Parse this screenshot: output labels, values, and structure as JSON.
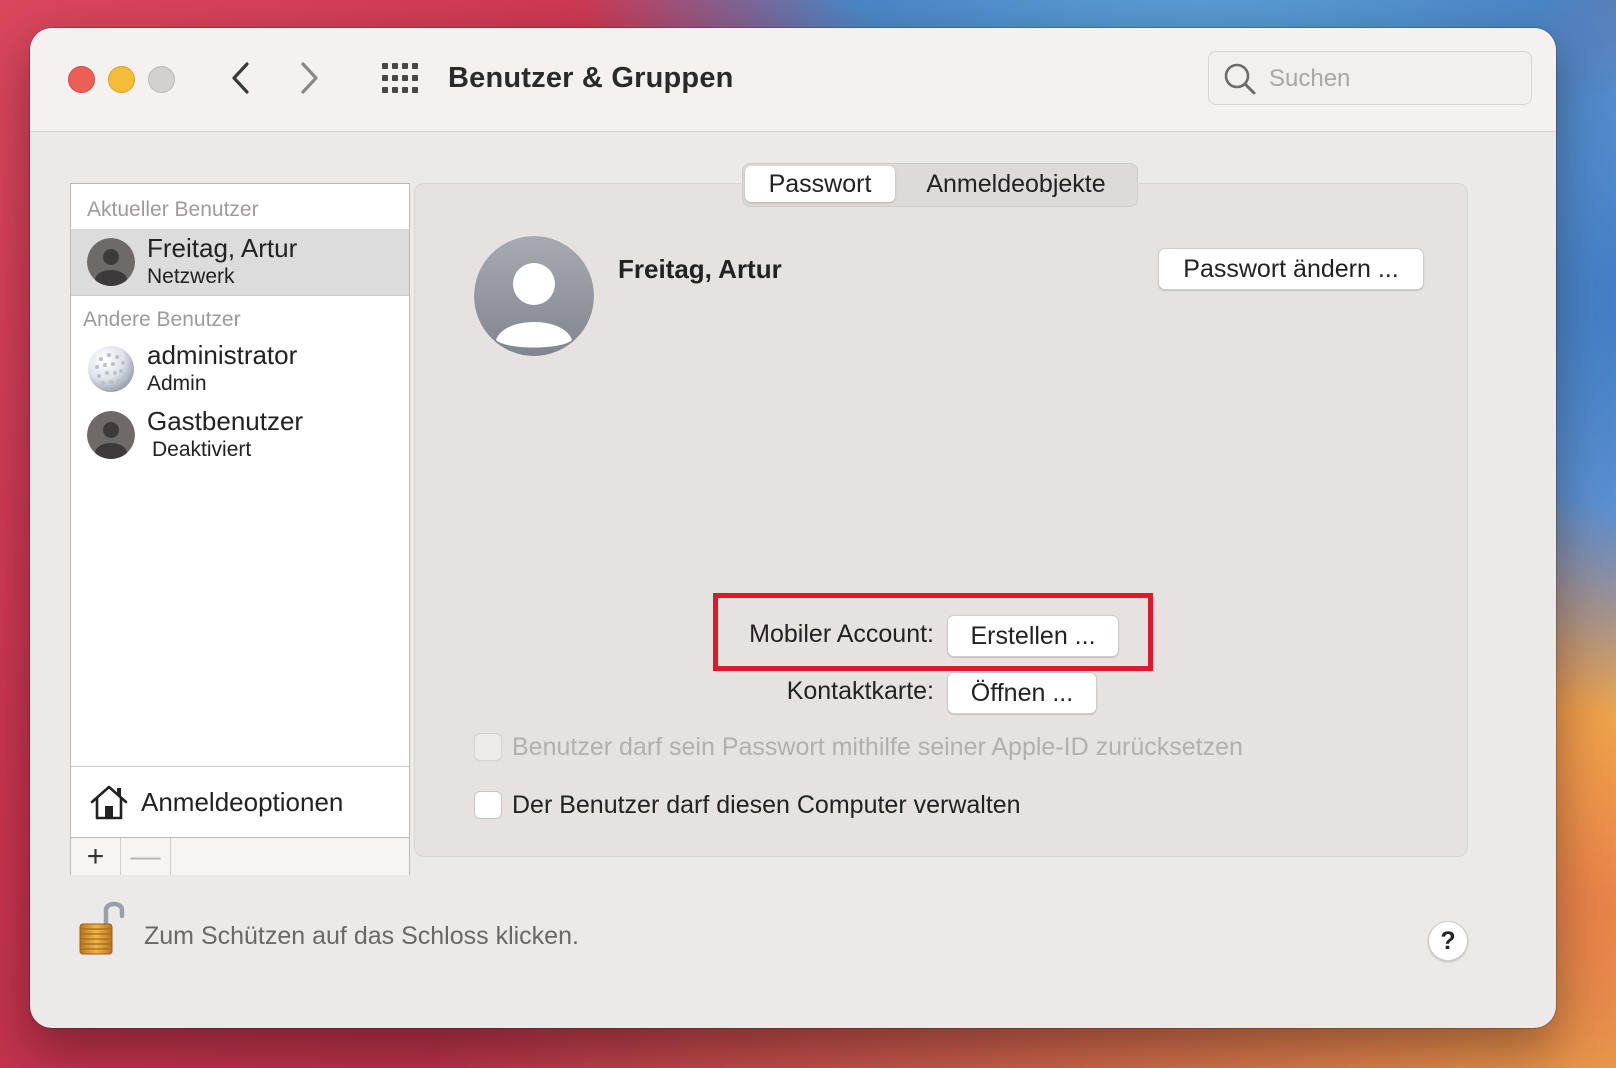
{
  "window": {
    "title": "Benutzer & Gruppen"
  },
  "search": {
    "placeholder": "Suchen"
  },
  "sidebar": {
    "current_section": "Aktueller Benutzer",
    "current_user": {
      "name": "Freitag, Artur",
      "role": "Netzwerk"
    },
    "other_section": "Andere Benutzer",
    "other_users": [
      {
        "name": "administrator",
        "role": "Admin"
      },
      {
        "name": "Gastbenutzer",
        "role": "Deaktiviert"
      }
    ],
    "login_options_label": "Anmeldeoptionen",
    "add_label": "+",
    "remove_label": "—"
  },
  "tabs": [
    {
      "label": "Passwort",
      "active": true
    },
    {
      "label": "Anmeldeobjekte",
      "active": false
    }
  ],
  "main": {
    "user_name": "Freitag, Artur",
    "change_password_label": "Passwort ändern ...",
    "mobile_account_label": "Mobiler Account:",
    "create_label": "Erstellen ...",
    "contact_card_label": "Kontaktkarte:",
    "open_label": "Öffnen ...",
    "checkbox_apple_id": {
      "label": "Benutzer darf sein Passwort mithilfe seiner Apple-ID zurücksetzen",
      "checked": false,
      "enabled": false
    },
    "checkbox_admin": {
      "label": "Der Benutzer darf diesen Computer verwalten",
      "checked": false,
      "enabled": true
    }
  },
  "footer": {
    "lock_text": "Zum Schützen auf das Schloss klicken.",
    "help_label": "?"
  },
  "colors": {
    "highlight": "#e0182a",
    "close": "#ec5f57",
    "minimize": "#f5bd35"
  }
}
